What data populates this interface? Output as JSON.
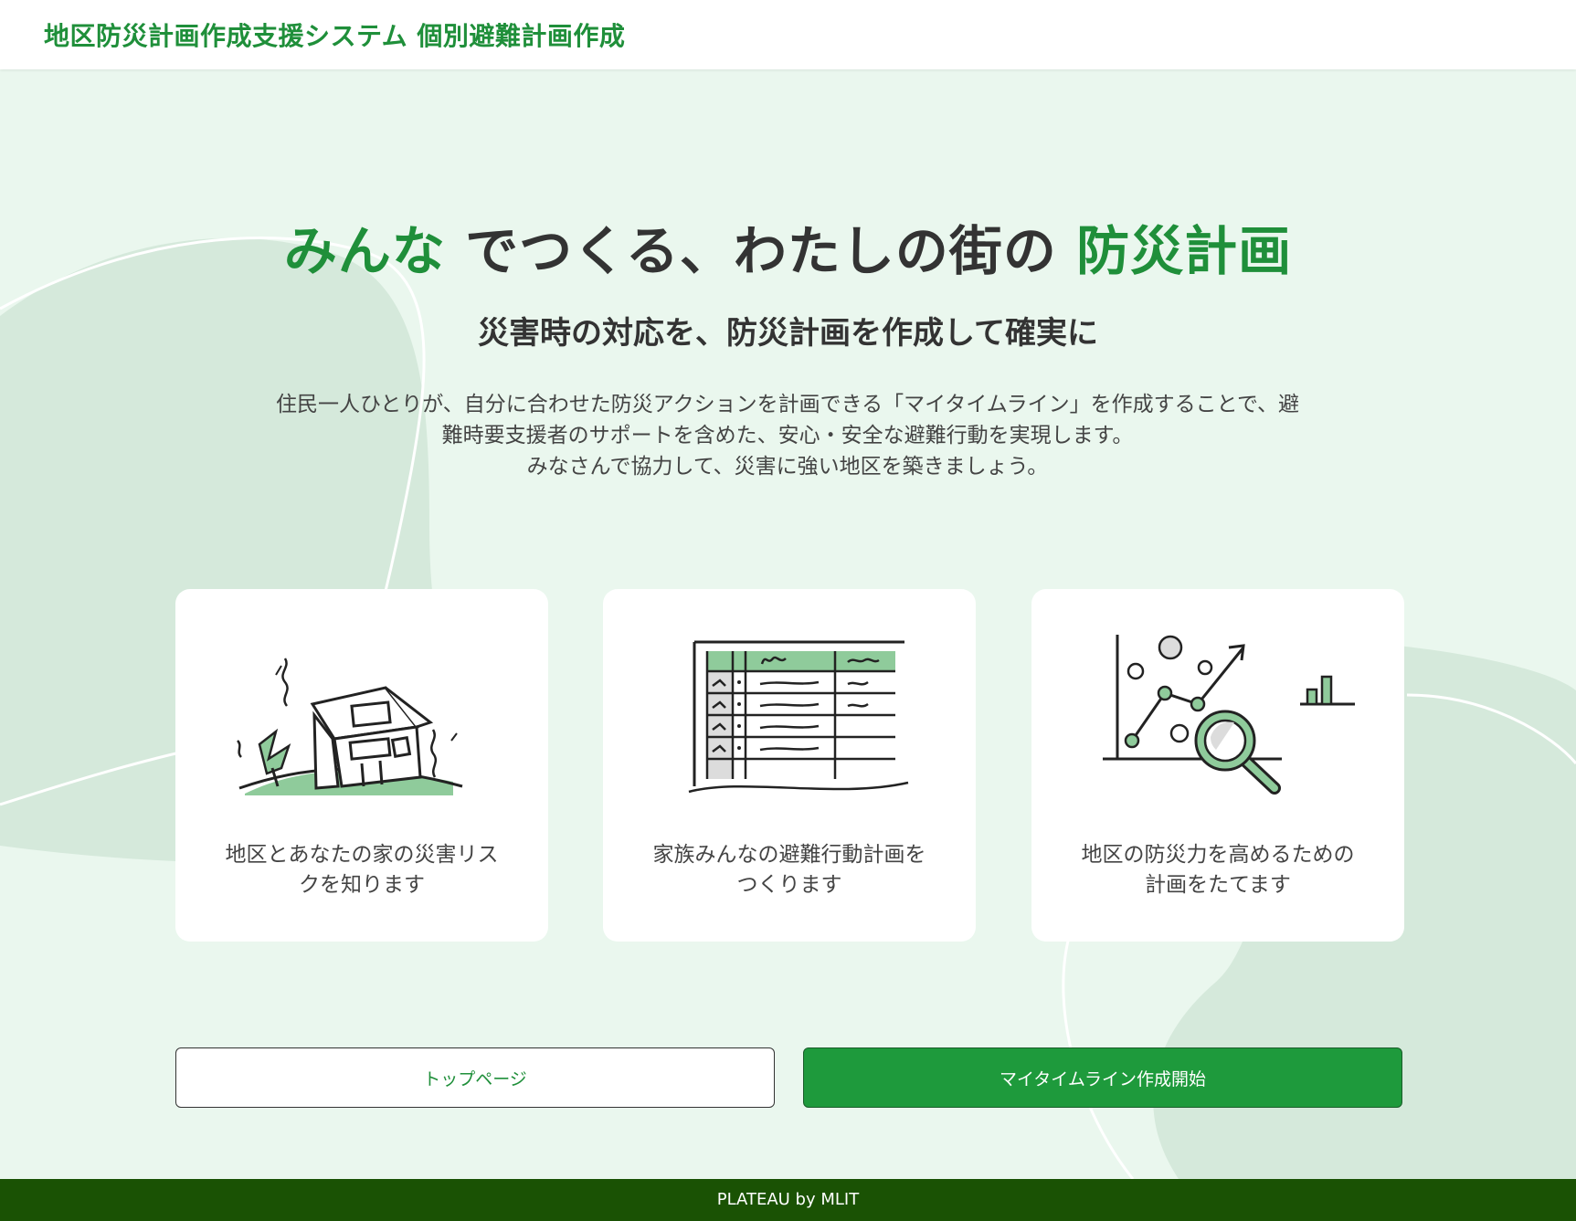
{
  "header": {
    "title": "地区防災計画作成支援システム 個別避難計画作成"
  },
  "hero": {
    "headline_accent_1": "みんな",
    "headline_mid": "でつくる、わたしの街の",
    "headline_accent_2": "防災計画",
    "subheadline": "災害時の対応を、防災計画を作成して確実に",
    "description_line1": "住民一人ひとりが、自分に合わせた防災アクションを計画できる「マイタイムライン」を作成することで、避",
    "description_line2": "難時要支援者のサポートを含めた、安心・安全な避難行動を実現します。",
    "description_line3": "みなさんで協力して、災害に強い地区を築きましょう。"
  },
  "cards": [
    {
      "icon": "house-disaster-icon",
      "caption_line1": "地区とあなたの家の災害リス",
      "caption_line2": "クを知ります"
    },
    {
      "icon": "table-plan-icon",
      "caption_line1": "家族みんなの避難行動計画を",
      "caption_line2": "つくります"
    },
    {
      "icon": "chart-analysis-icon",
      "caption_line1": "地区の防災力を高めるための",
      "caption_line2": "計画をたてます"
    }
  ],
  "buttons": {
    "top_page": "トップページ",
    "start": "マイタイムライン作成開始"
  },
  "footer": {
    "text": "PLATEAU by MLIT"
  },
  "colors": {
    "accent": "#1f8f3a",
    "button_green": "#1e9a3c",
    "footer": "#1a5204",
    "background": "#eaf7ee"
  }
}
